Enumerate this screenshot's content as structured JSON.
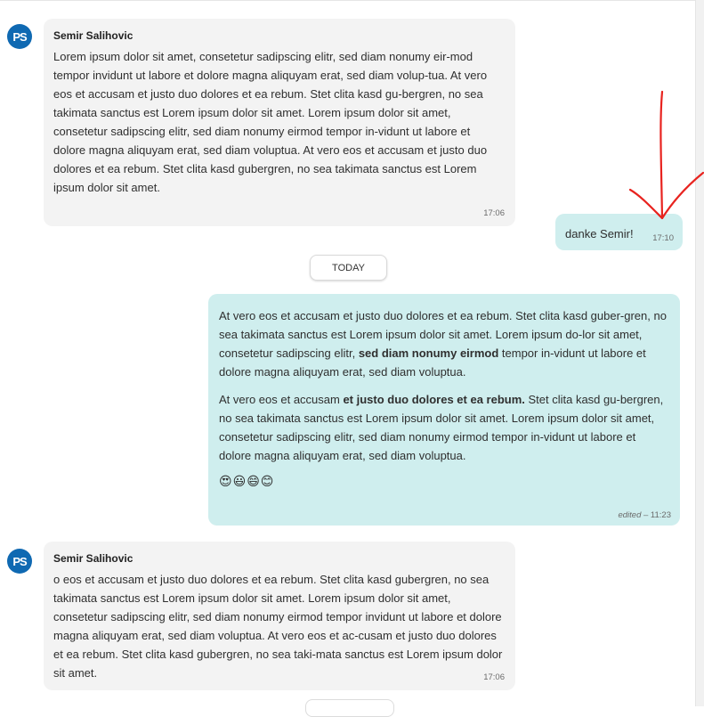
{
  "messages": [
    {
      "avatar": "PS",
      "sender": "Semir Salihovic",
      "text": "Lorem ipsum dolor sit amet, consetetur sadipscing elitr, sed diam nonumy eir-mod tempor invidunt ut labore et dolore magna aliquyam erat, sed diam volup-tua. At vero eos et accusam et justo duo dolores et ea rebum. Stet clita kasd gu-bergren, no sea takimata sanctus est Lorem ipsum dolor sit amet. Lorem ipsum dolor sit amet, consetetur sadipscing elitr, sed diam nonumy eirmod tempor in-vidunt ut labore et dolore magna aliquyam erat, sed diam voluptua. At vero eos et accusam et justo duo dolores et ea rebum. Stet clita kasd gubergren, no sea takimata sanctus est Lorem ipsum dolor sit amet.",
      "time": "17:06"
    },
    {
      "text": "danke Semir!",
      "time": "17:10"
    },
    {
      "para1_a": "At vero eos et accusam et justo duo dolores et ea rebum. Stet clita kasd guber-gren, no sea takimata sanctus est Lorem ipsum dolor sit amet. Lorem ipsum do-lor sit amet, consetetur sadipscing elitr, ",
      "para1_bold": "sed diam nonumy eirmod",
      "para1_b": " tempor in-vidunt ut labore et dolore magna aliquyam erat, sed diam voluptua.",
      "para2_a": "At vero eos et accusam ",
      "para2_bold": "et justo duo dolores et ea rebum.",
      "para2_b": " Stet clita kasd gu-bergren, no sea takimata sanctus est Lorem ipsum dolor sit amet. Lorem ipsum dolor sit amet, consetetur sadipscing elitr, sed diam nonumy eirmod tempor in-vidunt ut labore et dolore magna aliquyam erat, sed diam voluptua.",
      "emojis": "😍😃😄😊",
      "edited_label": "edited",
      "time": " – 11:23"
    },
    {
      "avatar": "PS",
      "sender": "Semir Salihovic",
      "text": "o eos et accusam et justo duo dolores et ea rebum. Stet clita kasd gubergren, no sea takimata sanctus est Lorem ipsum dolor sit amet. Lorem ipsum dolor sit amet, consetetur sadipscing elitr, sed diam nonumy eirmod tempor invidunt ut labore et dolore magna aliquyam erat, sed diam voluptua. At vero eos et ac-cusam et justo duo dolores et ea rebum. Stet clita kasd gubergren, no sea taki-mata sanctus est Lorem ipsum dolor sit amet.",
      "time": "17:06"
    }
  ],
  "day_separator": "TODAY",
  "colors": {
    "avatar": "#0f69b2",
    "received_bubble": "#f3f3f3",
    "sent_bubble": "#cfeeee",
    "annotation_arrow": "#e8231f"
  }
}
